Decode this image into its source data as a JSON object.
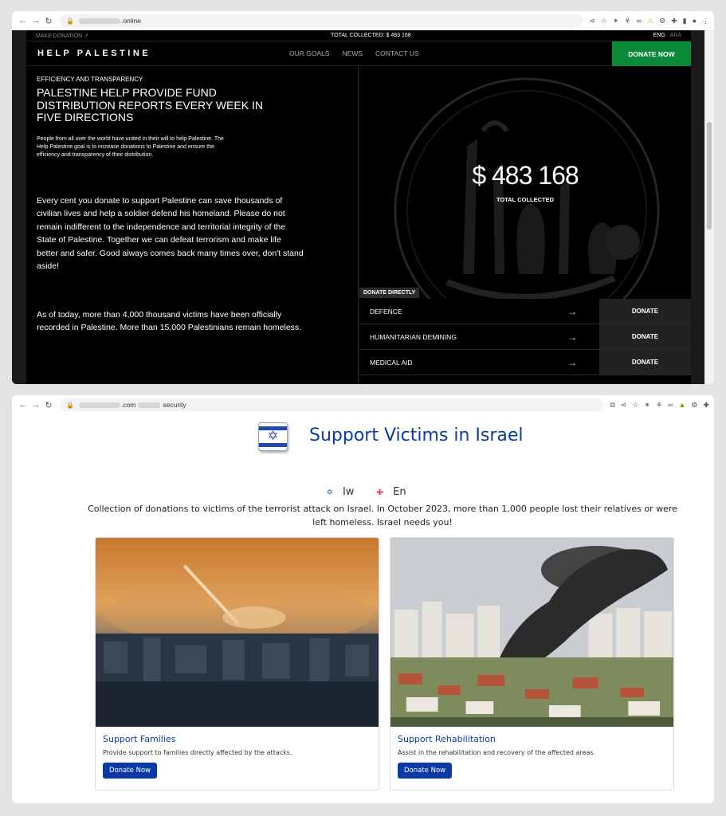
{
  "window1": {
    "url_suffix": ".online",
    "topbar": {
      "make_donation": "MAKE DONATION ↗",
      "total_collected": "TOTAL COLLECTED: $ 483 168",
      "lang_eng": "ENG",
      "lang_sep": " · ",
      "lang_ara": "ARA"
    },
    "logo": "HELP PALESTINE",
    "menu": [
      "OUR GOALS",
      "NEWS",
      "CONTACT US"
    ],
    "donate_now": "DONATE NOW",
    "eyebrow": "EFFICIENCY AND TRANSPARENCY",
    "headline": "PALESTINE HELP PROVIDE FUND DISTRIBUTION REPORTS EVERY WEEK IN FIVE DIRECTIONS",
    "intro": "People from all over the world have united in their will to help Palestine. The Help Palestine goal is to increase donations to Palestine and ensure the efficiency and transparency of their distribution.",
    "paragraph1": "Every cent you donate to support Palestine can save thousands of civilian lives and help a soldier defend his homeland. Please do not remain indifferent to the independence and territorial integrity of the State of Palestine. Together we can defeat terrorism and make life better and safer. Good always comes back many times over, don't stand aside!",
    "paragraph2": "As of today, more than 4,000 thousand victims have been officially recorded in Palestine. More than 15,000 Palestinians remain homeless.",
    "amount": "$ 483 168",
    "amount_label": "TOTAL COLLECTED",
    "donate_directly": "DONATE DIRECTLY",
    "directions": [
      {
        "name": "DEFENCE",
        "arrow": "→",
        "button": "DONATE"
      },
      {
        "name": "HUMANITARIAN DEMINING",
        "arrow": "→",
        "button": "DONATE"
      },
      {
        "name": "MEDICAL AID",
        "arrow": "→",
        "button": "DONATE"
      }
    ]
  },
  "window2": {
    "url_domain": ".com",
    "url_word": "security",
    "title": "Support Victims in Israel",
    "lang_iw": "Iw",
    "lang_en": "En",
    "lang_iw_flag": "✡",
    "lang_en_flag": "✙",
    "description": "Collection of donations to victims of the terrorist attack on Israel. In October 2023, more than 1,000 people lost their relatives or were left homeless. Israel needs you!",
    "cards": [
      {
        "title": "Support Families",
        "text": "Provide support to families directly affected by the attacks.",
        "button": "Donate Now"
      },
      {
        "title": "Support Rehabilitation",
        "text": "Assist in the rehabilitation and recovery of the affected areas.",
        "button": "Donate Now"
      }
    ]
  },
  "colors": {
    "palestine_green": "#0b8a3a",
    "israel_blue": "#0b3aa6"
  }
}
